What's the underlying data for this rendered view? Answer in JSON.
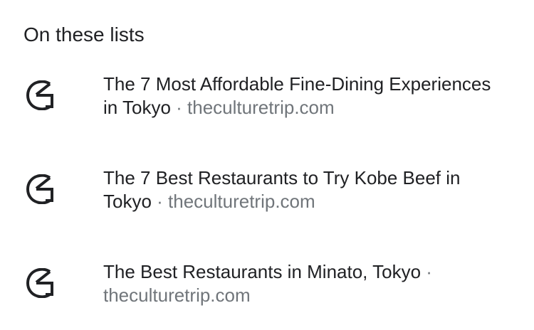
{
  "section": {
    "title": "On these lists"
  },
  "lists": [
    {
      "title": "The 7 Most Affordable Fine-Dining Experiences in Tokyo",
      "separator": " · ",
      "source": "theculturetrip.com",
      "icon": "culture-trip-logo-icon"
    },
    {
      "title": "The 7 Best Restaurants to Try Kobe Beef in Tokyo",
      "separator": " · ",
      "source": "theculturetrip.com",
      "icon": "culture-trip-logo-icon"
    },
    {
      "title": "The Best Restaurants in Minato, Tokyo",
      "separator": " · ",
      "source": "theculturetrip.com",
      "icon": "culture-trip-logo-icon"
    }
  ],
  "colors": {
    "text_primary": "#202124",
    "text_secondary": "#70757a",
    "background": "#ffffff"
  }
}
